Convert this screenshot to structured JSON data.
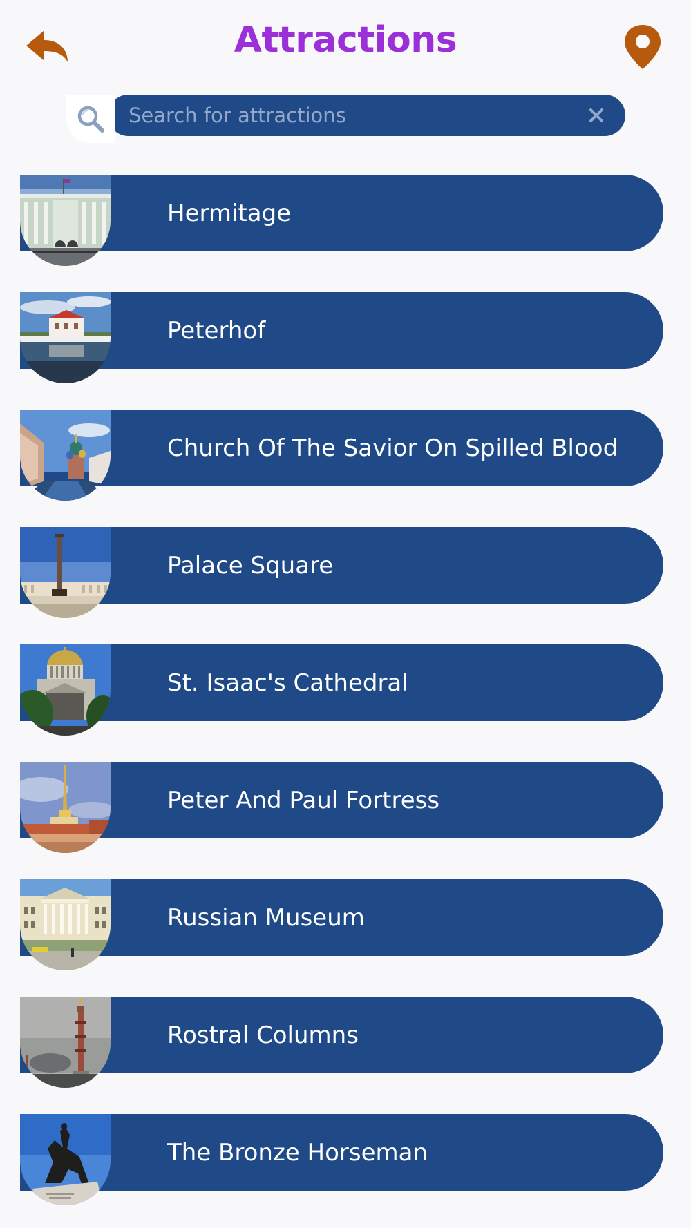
{
  "header": {
    "title": "Attractions",
    "back_icon": "back-arrow-icon",
    "location_icon": "location-pin-icon",
    "accent_color": "#9b30d9",
    "icon_color": "#b85a0e"
  },
  "search": {
    "placeholder": "Search for attractions",
    "value": "",
    "search_icon": "search-icon",
    "clear_icon": "close-icon"
  },
  "attractions": [
    {
      "label": "Hermitage",
      "image": "hermitage-photo"
    },
    {
      "label": "Peterhof",
      "image": "peterhof-photo"
    },
    {
      "label": "Church Of The Savior On Spilled Blood",
      "image": "church-savior-photo"
    },
    {
      "label": "Palace Square",
      "image": "palace-square-photo"
    },
    {
      "label": "St. Isaac's Cathedral",
      "image": "st-isaacs-photo"
    },
    {
      "label": "Peter And Paul Fortress",
      "image": "peter-paul-fortress-photo"
    },
    {
      "label": "Russian Museum",
      "image": "russian-museum-photo"
    },
    {
      "label": "Rostral Columns",
      "image": "rostral-columns-photo"
    },
    {
      "label": "The Bronze Horseman",
      "image": "bronze-horseman-photo"
    }
  ],
  "colors": {
    "background": "#f8f7f9",
    "pill": "#1f4a87",
    "label_text": "#ffffff"
  }
}
